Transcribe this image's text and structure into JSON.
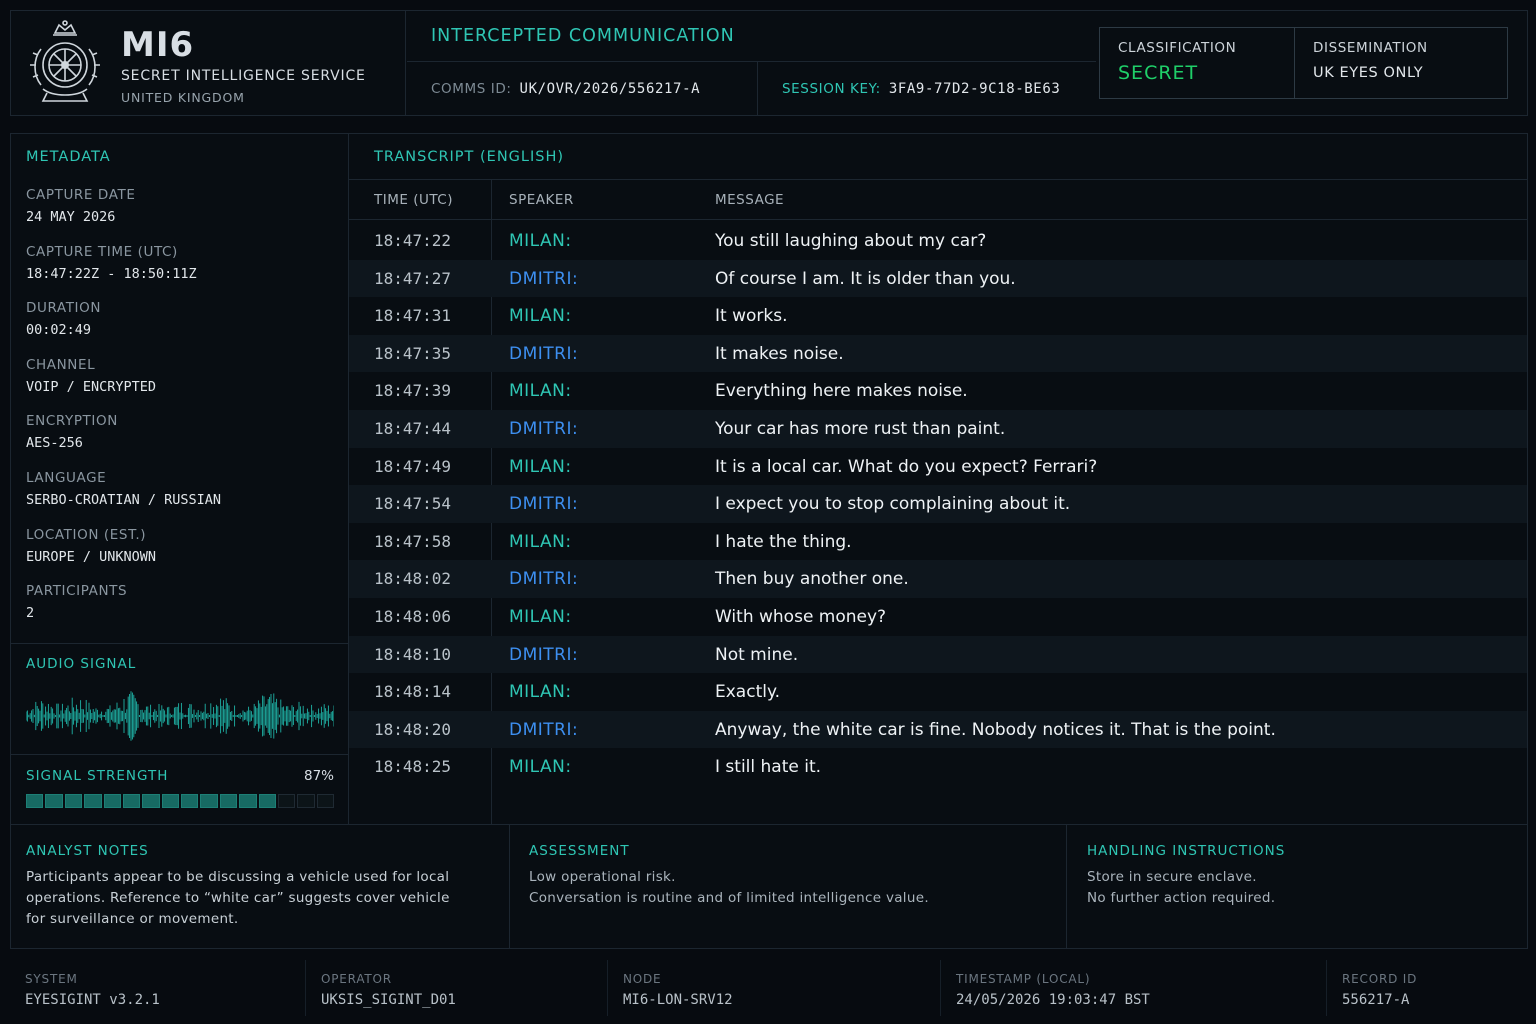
{
  "colors": {
    "accent": "#2fc6b4",
    "speaker_alt": "#3d8ff0",
    "classification": "#1fcf69",
    "background": "#070b10"
  },
  "header": {
    "crest_icon": "royal-crest-icon",
    "title": "MI6",
    "subtitle": "SECRET INTELLIGENCE SERVICE",
    "country": "UNITED KINGDOM",
    "comm_title": "INTERCEPTED COMMUNICATION",
    "comms_id_label": "COMMS ID:",
    "comms_id": "UK/OVR/2026/556217-A",
    "session_key_label": "SESSION KEY:",
    "session_key": "3FA9-77D2-9C18-BE63",
    "classification_label": "CLASSIFICATION",
    "classification": "SECRET",
    "dissemination_label": "DISSEMINATION",
    "dissemination": "UK EYES ONLY"
  },
  "metadata": {
    "title": "METADATA",
    "items": [
      {
        "label": "CAPTURE DATE",
        "value": "24 MAY 2026"
      },
      {
        "label": "CAPTURE TIME (UTC)",
        "value": "18:47:22Z - 18:50:11Z"
      },
      {
        "label": "DURATION",
        "value": "00:02:49"
      },
      {
        "label": "CHANNEL",
        "value": "VOIP / ENCRYPTED"
      },
      {
        "label": "ENCRYPTION",
        "value": "AES-256"
      },
      {
        "label": "LANGUAGE",
        "value": "SERBO-CROATIAN / RUSSIAN"
      },
      {
        "label": "LOCATION (EST.)",
        "value": "EUROPE / UNKNOWN"
      },
      {
        "label": "PARTICIPANTS",
        "value": "2"
      }
    ]
  },
  "audio": {
    "title": "AUDIO SIGNAL"
  },
  "signal": {
    "title": "SIGNAL STRENGTH",
    "percent_label": "87%",
    "level": 0.87,
    "segments": 16
  },
  "transcript": {
    "title": "TRANSCRIPT (ENGLISH)",
    "headers": {
      "time": "TIME (UTC)",
      "speaker": "SPEAKER",
      "message": "MESSAGE"
    },
    "rows": [
      {
        "time": "18:47:22",
        "speaker": "MILAN:",
        "message": "You still laughing about my car?"
      },
      {
        "time": "18:47:27",
        "speaker": "DMITRI:",
        "message": "Of course I am. It is older than you."
      },
      {
        "time": "18:47:31",
        "speaker": "MILAN:",
        "message": "It works."
      },
      {
        "time": "18:47:35",
        "speaker": "DMITRI:",
        "message": "It makes noise."
      },
      {
        "time": "18:47:39",
        "speaker": "MILAN:",
        "message": "Everything here makes noise."
      },
      {
        "time": "18:47:44",
        "speaker": "DMITRI:",
        "message": "Your car has more rust than paint."
      },
      {
        "time": "18:47:49",
        "speaker": "MILAN:",
        "message": "It is a local car. What do you expect? Ferrari?"
      },
      {
        "time": "18:47:54",
        "speaker": "DMITRI:",
        "message": "I expect you to stop complaining about it."
      },
      {
        "time": "18:47:58",
        "speaker": "MILAN:",
        "message": "I hate the thing."
      },
      {
        "time": "18:48:02",
        "speaker": "DMITRI:",
        "message": "Then buy another one."
      },
      {
        "time": "18:48:06",
        "speaker": "MILAN:",
        "message": "With whose money?"
      },
      {
        "time": "18:48:10",
        "speaker": "DMITRI:",
        "message": "Not mine."
      },
      {
        "time": "18:48:14",
        "speaker": "MILAN:",
        "message": "Exactly."
      },
      {
        "time": "18:48:20",
        "speaker": "DMITRI:",
        "message": "Anyway, the white car is fine. Nobody notices it. That is the point."
      },
      {
        "time": "18:48:25",
        "speaker": "MILAN:",
        "message": "I still hate it."
      }
    ]
  },
  "notes": {
    "analyst_title": "ANALYST NOTES",
    "analyst_line1": "Participants appear to be discussing a vehicle used for local",
    "analyst_line2": "operations. Reference to “white car” suggests cover vehicle",
    "analyst_line3": "for surveillance or movement.",
    "assessment_title": "ASSESSMENT",
    "assessment_line1": "Low operational risk.",
    "assessment_line2": "Conversation is routine and of limited intelligence value.",
    "handling_title": "HANDLING INSTRUCTIONS",
    "handling_line1": "Store in secure enclave.",
    "handling_line2": "No further action required."
  },
  "footer": [
    {
      "label": "SYSTEM",
      "value": "EYESIGINT v3.2.1"
    },
    {
      "label": "OPERATOR",
      "value": "UKSIS_SIGINT_D01"
    },
    {
      "label": "NODE",
      "value": "MI6-LON-SRV12"
    },
    {
      "label": "TIMESTAMP (LOCAL)",
      "value": "24/05/2026 19:03:47 BST"
    },
    {
      "label": "RECORD ID",
      "value": "556217-A"
    }
  ]
}
